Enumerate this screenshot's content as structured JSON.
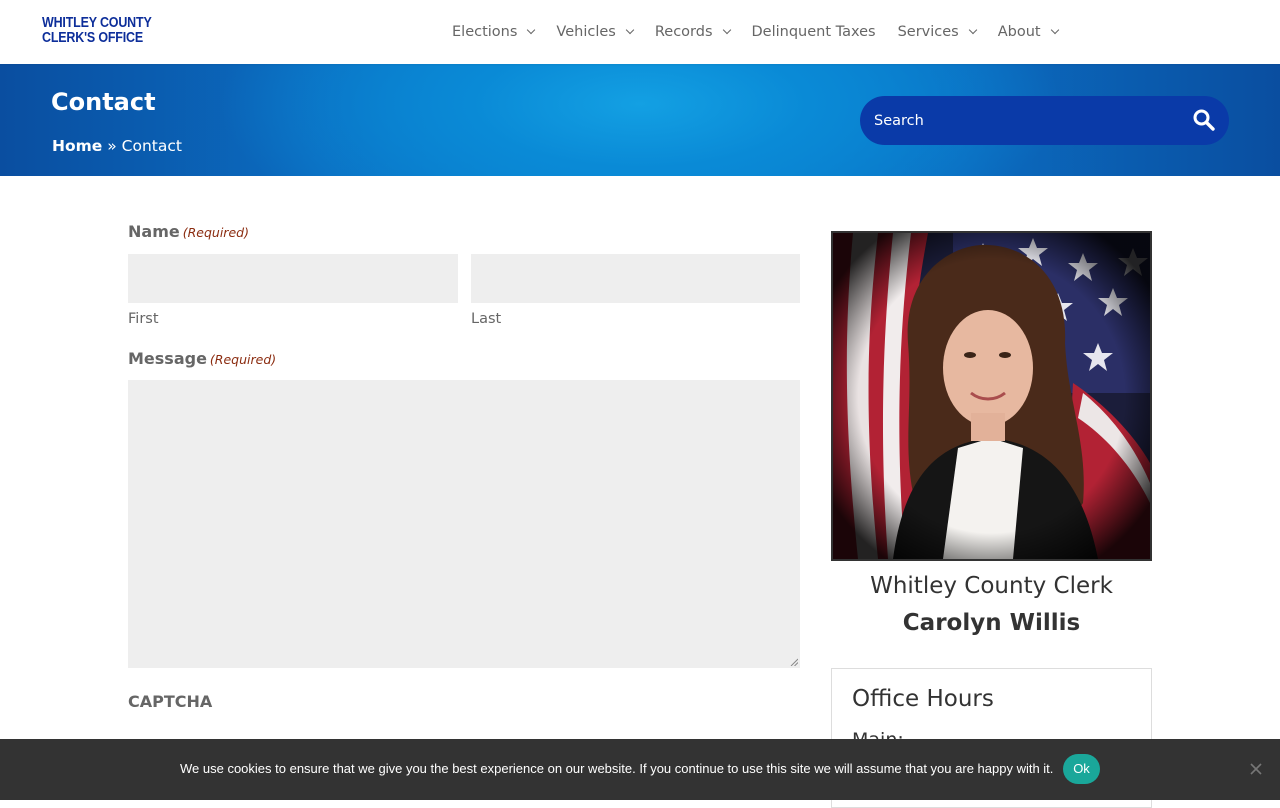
{
  "header": {
    "logo_line1": "WHITLEY COUNTY",
    "logo_line2": "CLERK'S OFFICE",
    "nav": [
      {
        "label": "Elections",
        "dropdown": true
      },
      {
        "label": "Vehicles",
        "dropdown": true
      },
      {
        "label": "Records",
        "dropdown": true
      },
      {
        "label": "Delinquent Taxes",
        "dropdown": false
      },
      {
        "label": "Services",
        "dropdown": true
      },
      {
        "label": "About",
        "dropdown": true
      }
    ]
  },
  "banner": {
    "title": "Contact",
    "breadcrumb_home": "Home",
    "breadcrumb_sep": " » ",
    "breadcrumb_current": "Contact",
    "search_placeholder": "Search"
  },
  "form": {
    "name_label": "Name",
    "required_tag": "(Required)",
    "first_label": "First",
    "last_label": "Last",
    "message_label": "Message",
    "captcha_label": "CAPTCHA",
    "first_value": "",
    "last_value": "",
    "message_value": ""
  },
  "sidebar": {
    "clerk_title": "Whitley County Clerk",
    "clerk_name": "Carolyn Willis",
    "hours_title": "Office Hours",
    "hours_sub": "Main:"
  },
  "cookie": {
    "text": "We use cookies to ensure that we give you the best experience on our website. If you continue to use this site we will assume that you are happy with it.",
    "ok_label": "Ok"
  },
  "colors": {
    "logo_blue": "#0d2e9a",
    "search_bg": "#0a3aa8",
    "required_red": "#8b2c10",
    "cookie_ok": "#1aa79a"
  }
}
